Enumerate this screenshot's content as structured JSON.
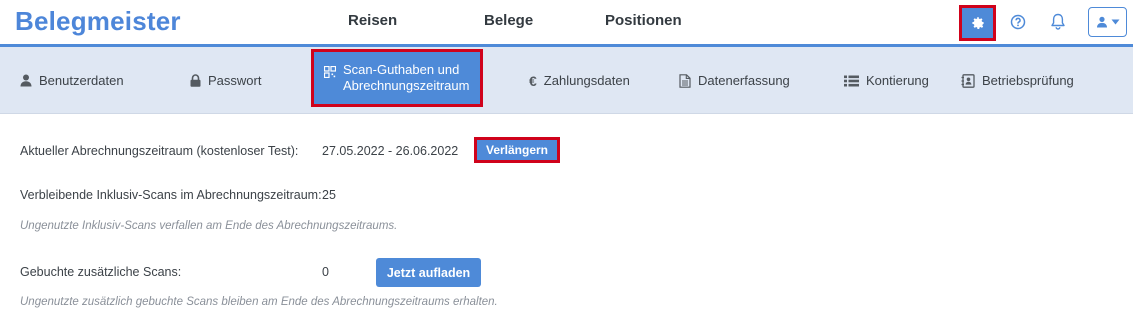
{
  "app": {
    "brand": "Belegmeister"
  },
  "topnav": [
    {
      "label": "Reisen"
    },
    {
      "label": "Belege"
    },
    {
      "label": "Positionen"
    }
  ],
  "icons": {
    "settings": "gear-icon",
    "help": "question-circle-icon",
    "notifications": "bell-icon",
    "user": "user-icon"
  },
  "colors": {
    "accent": "#4e8ad8",
    "highlight": "#d0021b",
    "subnav_bg": "#dfe7f3"
  },
  "subnav": [
    {
      "label": "Benutzerdaten",
      "icon": "user-icon"
    },
    {
      "label": "Passwort",
      "icon": "lock-icon"
    },
    {
      "label_line1": "Scan-Guthaben und",
      "label_line2": "Abrechnungszeitraum",
      "icon": "qr-icon",
      "active": true
    },
    {
      "label": "Zahlungsdaten",
      "icon": "euro-icon"
    },
    {
      "label": "Datenerfassung",
      "icon": "document-icon"
    },
    {
      "label": "Kontierung",
      "icon": "list-icon"
    },
    {
      "label": "Betriebsprüfung",
      "icon": "contact-book-icon"
    }
  ],
  "billing": {
    "period_label": "Aktueller Abrechnungszeitraum (kostenloser Test):",
    "period_value": "27.05.2022 - 26.06.2022",
    "extend_button": "Verlängern",
    "remaining_label": "Verbleibende Inklusiv-Scans im Abrechnungszeitraum:",
    "remaining_value": "25",
    "remaining_hint": "Ungenutzte Inklusiv-Scans verfallen am Ende des Abrechnungszeitraums.",
    "extra_label": "Gebuchte zusätzliche Scans:",
    "extra_value": "0",
    "topup_button": "Jetzt aufladen",
    "extra_hint": "Ungenutzte zusätzlich gebuchte Scans bleiben am Ende des Abrechnungszeitraums erhalten."
  }
}
